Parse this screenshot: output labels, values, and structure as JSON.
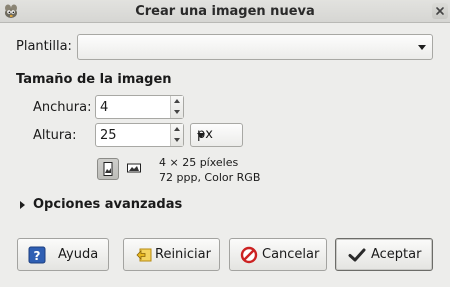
{
  "window": {
    "title": "Crear una imagen nueva"
  },
  "template": {
    "label": "Plantilla:",
    "value": ""
  },
  "image_size": {
    "heading": "Tamaño de la imagen",
    "width_label": "Anchura:",
    "width_value": "4",
    "height_label": "Altura:",
    "height_value": "25",
    "unit": "px",
    "orientation": "portrait",
    "info_dimensions": "4 × 25 píxeles",
    "info_resolution": "72 ppp, Color RGB"
  },
  "advanced": {
    "label": "Opciones avanzadas",
    "expanded": false
  },
  "buttons": {
    "help": "Ayuda",
    "reset": "Reiniciar",
    "cancel": "Cancelar",
    "ok": "Aceptar"
  },
  "colors": {
    "dialog_bg": "#ededeb",
    "help_icon_blue": "#2f5fb3",
    "reset_icon_yellow": "#e8b820",
    "cancel_icon_red": "#cc2222",
    "ok_check": "#2a2a2a"
  },
  "icons": {
    "app": "gimp-icon",
    "close": "close-icon",
    "portrait": "portrait-orientation-icon",
    "landscape": "landscape-orientation-icon",
    "help": "help-icon",
    "reset": "reset-icon",
    "cancel": "cancel-icon",
    "ok": "checkmark-icon"
  }
}
